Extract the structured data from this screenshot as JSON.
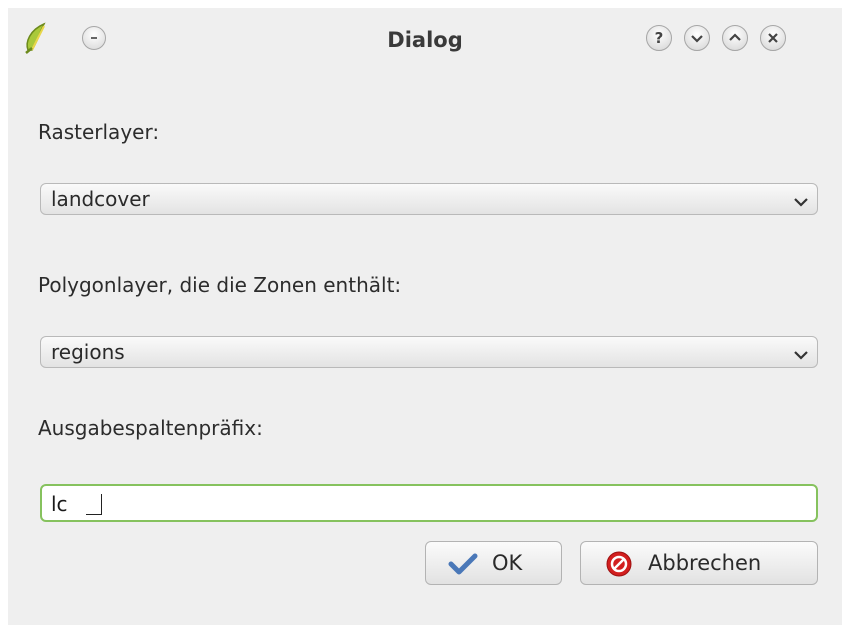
{
  "window": {
    "title": "Dialog",
    "help_symbol": "?"
  },
  "form": {
    "raster_label": "Rasterlayer:",
    "raster_value": "landcover",
    "polygon_label": "Polygonlayer, die die Zonen enthält:",
    "polygon_value": "regions",
    "prefix_label": "Ausgabespaltenpräfix:",
    "prefix_value": "lc"
  },
  "buttons": {
    "ok_label": "OK",
    "cancel_label": "Abbrechen"
  },
  "icons": {
    "app": "qgis-icon",
    "menu": "window-menu-icon",
    "help": "help-icon",
    "minimize": "minimize-icon",
    "maximize": "maximize-icon",
    "close": "close-icon",
    "dropdown": "chevron-down-icon",
    "ok": "checkmark-icon",
    "cancel": "cancel-icon"
  },
  "colors": {
    "input_focus_border": "#86c25e",
    "ok_check": "#4a78b8",
    "cancel_red": "#d21f1f"
  }
}
